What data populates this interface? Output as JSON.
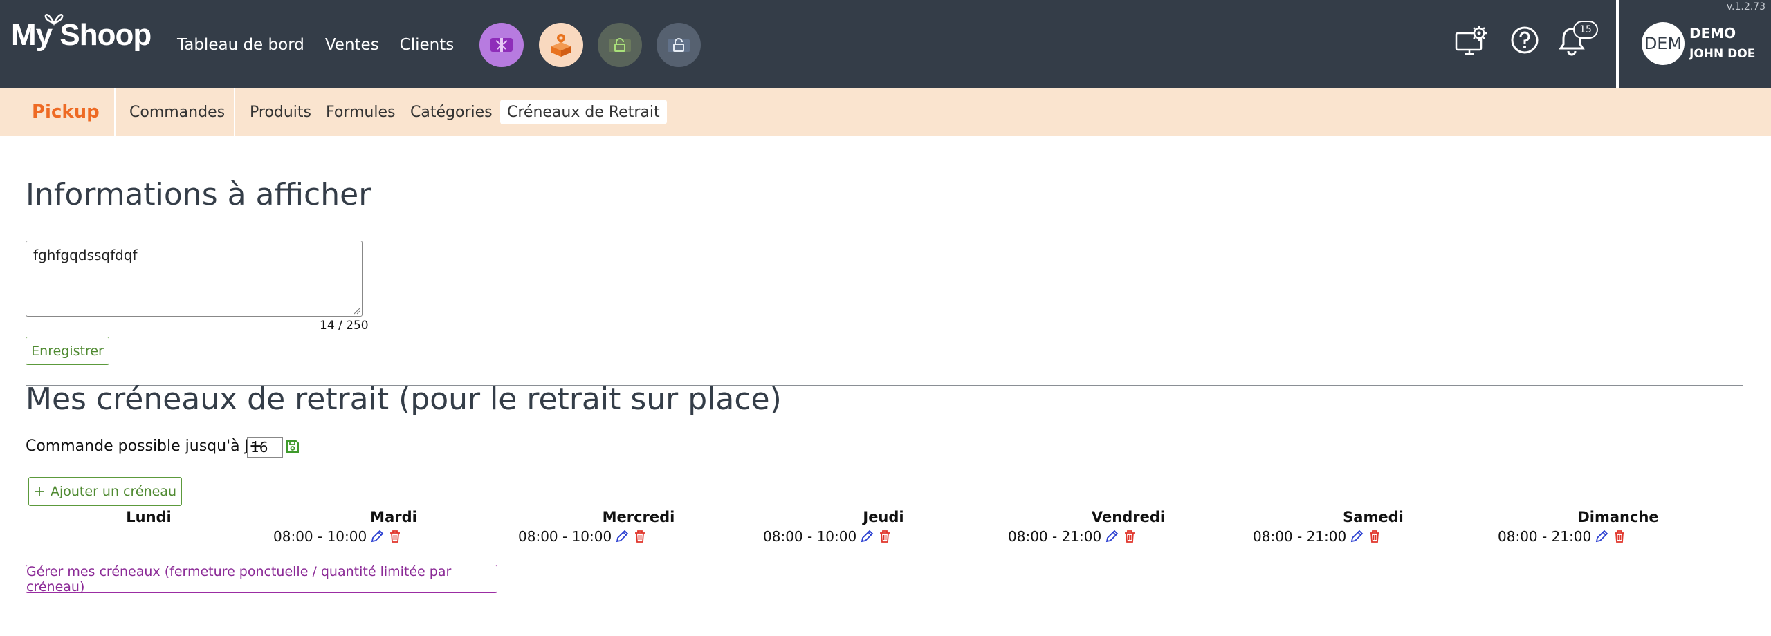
{
  "app": {
    "logo_text": "My Shoop",
    "version": "v.1.2.73"
  },
  "mainnav": [
    "Tableau de bord",
    "Ventes",
    "Clients"
  ],
  "quick_icons": [
    {
      "icon": "gift-icon",
      "color": "#b77be0"
    },
    {
      "icon": "package-pin-icon",
      "color": "#f9d9bf"
    },
    {
      "icon": "lock-icon",
      "color": "#59645a"
    },
    {
      "icon": "lock-icon",
      "color": "#566170"
    }
  ],
  "notifications": {
    "count": "15"
  },
  "user": {
    "initials": "DEM",
    "line1": "DEMO",
    "line2": "JOHN DOE"
  },
  "module": {
    "title": "Pickup",
    "tabs": [
      "Commandes",
      "Produits",
      "Formules",
      "Catégories",
      "Créneaux de Retrait"
    ],
    "active_tab": "Créneaux de Retrait"
  },
  "info_section": {
    "heading": "Informations à afficher",
    "textarea_value": "fghfgqdssqfdqf",
    "char_count": "14 / 250",
    "save_button": "Enregistrer"
  },
  "slots_section": {
    "heading": "Mes créneaux de retrait (pour le retrait sur place)",
    "order_label": "Commande possible jusqu'à J+",
    "order_days": "16",
    "add_button": "Ajouter un créneau",
    "days": [
      {
        "name": "Lundi",
        "slots": []
      },
      {
        "name": "Mardi",
        "slots": [
          "08:00 - 10:00"
        ]
      },
      {
        "name": "Mercredi",
        "slots": [
          "08:00 - 10:00"
        ]
      },
      {
        "name": "Jeudi",
        "slots": [
          "08:00 - 10:00"
        ]
      },
      {
        "name": "Vendredi",
        "slots": [
          "08:00 - 21:00"
        ]
      },
      {
        "name": "Samedi",
        "slots": [
          "08:00 - 21:00"
        ]
      },
      {
        "name": "Dimanche",
        "slots": [
          "08:00 - 21:00"
        ]
      }
    ],
    "manage_button": "Gérer mes créneaux (fermeture ponctuelle / quantité limitée par créneau)"
  },
  "colors": {
    "navbar": "#343d48",
    "subbar": "#fae4cf",
    "accent_orange": "#ee6a24",
    "green": "#4f8a31",
    "purple": "#8b2a96",
    "edit_blue": "#2a3fd1",
    "delete_red": "#e0352b"
  }
}
